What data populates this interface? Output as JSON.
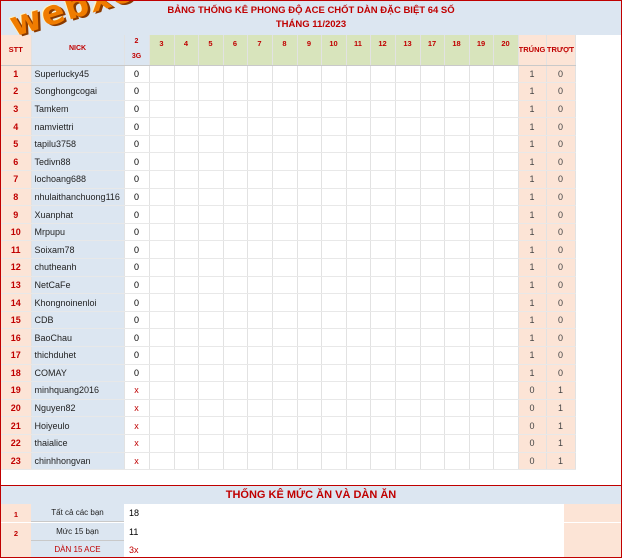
{
  "title": {
    "line1": "BẢNG THỐNG KÊ PHONG ĐỘ ACE CHỐT DÀN ĐẶC BIỆT 64 SỐ",
    "line2": "THÁNG 11/2023"
  },
  "logo": "webxoso.net",
  "headers": {
    "stt": "STT",
    "nick": "NICK",
    "day2": "2",
    "day3g": "3G",
    "days": [
      "3",
      "4",
      "5",
      "6",
      "7",
      "8",
      "9",
      "10",
      "11",
      "12",
      "13",
      "17",
      "18",
      "19",
      "20"
    ],
    "trung": "TRÚNG",
    "truot": "TRƯỢT"
  },
  "rows": [
    {
      "stt": "1",
      "nick": "Superlucky45",
      "value": "0",
      "trung": "1",
      "truot": "0"
    },
    {
      "stt": "2",
      "nick": "Songhongcogai",
      "value": "0",
      "trung": "1",
      "truot": "0"
    },
    {
      "stt": "3",
      "nick": "Tamkem",
      "value": "0",
      "trung": "1",
      "truot": "0"
    },
    {
      "stt": "4",
      "nick": "namviettri",
      "value": "0",
      "trung": "1",
      "truot": "0"
    },
    {
      "stt": "5",
      "nick": "tapilu3758",
      "value": "0",
      "trung": "1",
      "truot": "0"
    },
    {
      "stt": "6",
      "nick": "Tedivn88",
      "value": "0",
      "trung": "1",
      "truot": "0"
    },
    {
      "stt": "7",
      "nick": "lochoang688",
      "value": "0",
      "trung": "1",
      "truot": "0"
    },
    {
      "stt": "8",
      "nick": "nhulaithanchuong116",
      "value": "0",
      "trung": "1",
      "truot": "0"
    },
    {
      "stt": "9",
      "nick": "Xuanphat",
      "value": "0",
      "trung": "1",
      "truot": "0"
    },
    {
      "stt": "10",
      "nick": "Mrpupu",
      "value": "0",
      "trung": "1",
      "truot": "0"
    },
    {
      "stt": "11",
      "nick": "Soixam78",
      "value": "0",
      "trung": "1",
      "truot": "0"
    },
    {
      "stt": "12",
      "nick": "chutheanh",
      "value": "0",
      "trung": "1",
      "truot": "0"
    },
    {
      "stt": "13",
      "nick": "NetCaFe",
      "value": "0",
      "trung": "1",
      "truot": "0"
    },
    {
      "stt": "14",
      "nick": "Khongnoinenloi",
      "value": "0",
      "trung": "1",
      "truot": "0"
    },
    {
      "stt": "15",
      "nick": "CDB",
      "value": "0",
      "trung": "1",
      "truot": "0"
    },
    {
      "stt": "16",
      "nick": "BaoChau",
      "value": "0",
      "trung": "1",
      "truot": "0"
    },
    {
      "stt": "17",
      "nick": "thichduhet",
      "value": "0",
      "trung": "1",
      "truot": "0"
    },
    {
      "stt": "18",
      "nick": "COMAY",
      "value": "0",
      "trung": "1",
      "truot": "0"
    },
    {
      "stt": "19",
      "nick": "minhquang2016",
      "value": "x",
      "trung": "0",
      "truot": "1"
    },
    {
      "stt": "20",
      "nick": "Nguyen82",
      "value": "x",
      "trung": "0",
      "truot": "1"
    },
    {
      "stt": "21",
      "nick": "Hoiyeulo",
      "value": "x",
      "trung": "0",
      "truot": "1"
    },
    {
      "stt": "22",
      "nick": "thaialice",
      "value": "x",
      "trung": "0",
      "truot": "1"
    },
    {
      "stt": "23",
      "nick": "chinhhongvan",
      "value": "x",
      "trung": "0",
      "truot": "1"
    }
  ],
  "summary": {
    "title": "THỐNG KÊ MỨC ĂN VÀ DÀN ĂN",
    "rows": [
      {
        "num": "1",
        "label": "Tất cả các bạn",
        "value": "18"
      },
      {
        "num": "2",
        "label": "Mức 15 bạn",
        "value": "11"
      },
      {
        "num": "",
        "label": "DÀN 15 ACE",
        "value": "3x"
      }
    ]
  },
  "colors": {
    "accent_red": "#c00000",
    "nick_blue": "#dce6f1",
    "peach": "#fce4d6",
    "day_green": "#d8e4bc",
    "logo_orange": "#f07c00"
  }
}
